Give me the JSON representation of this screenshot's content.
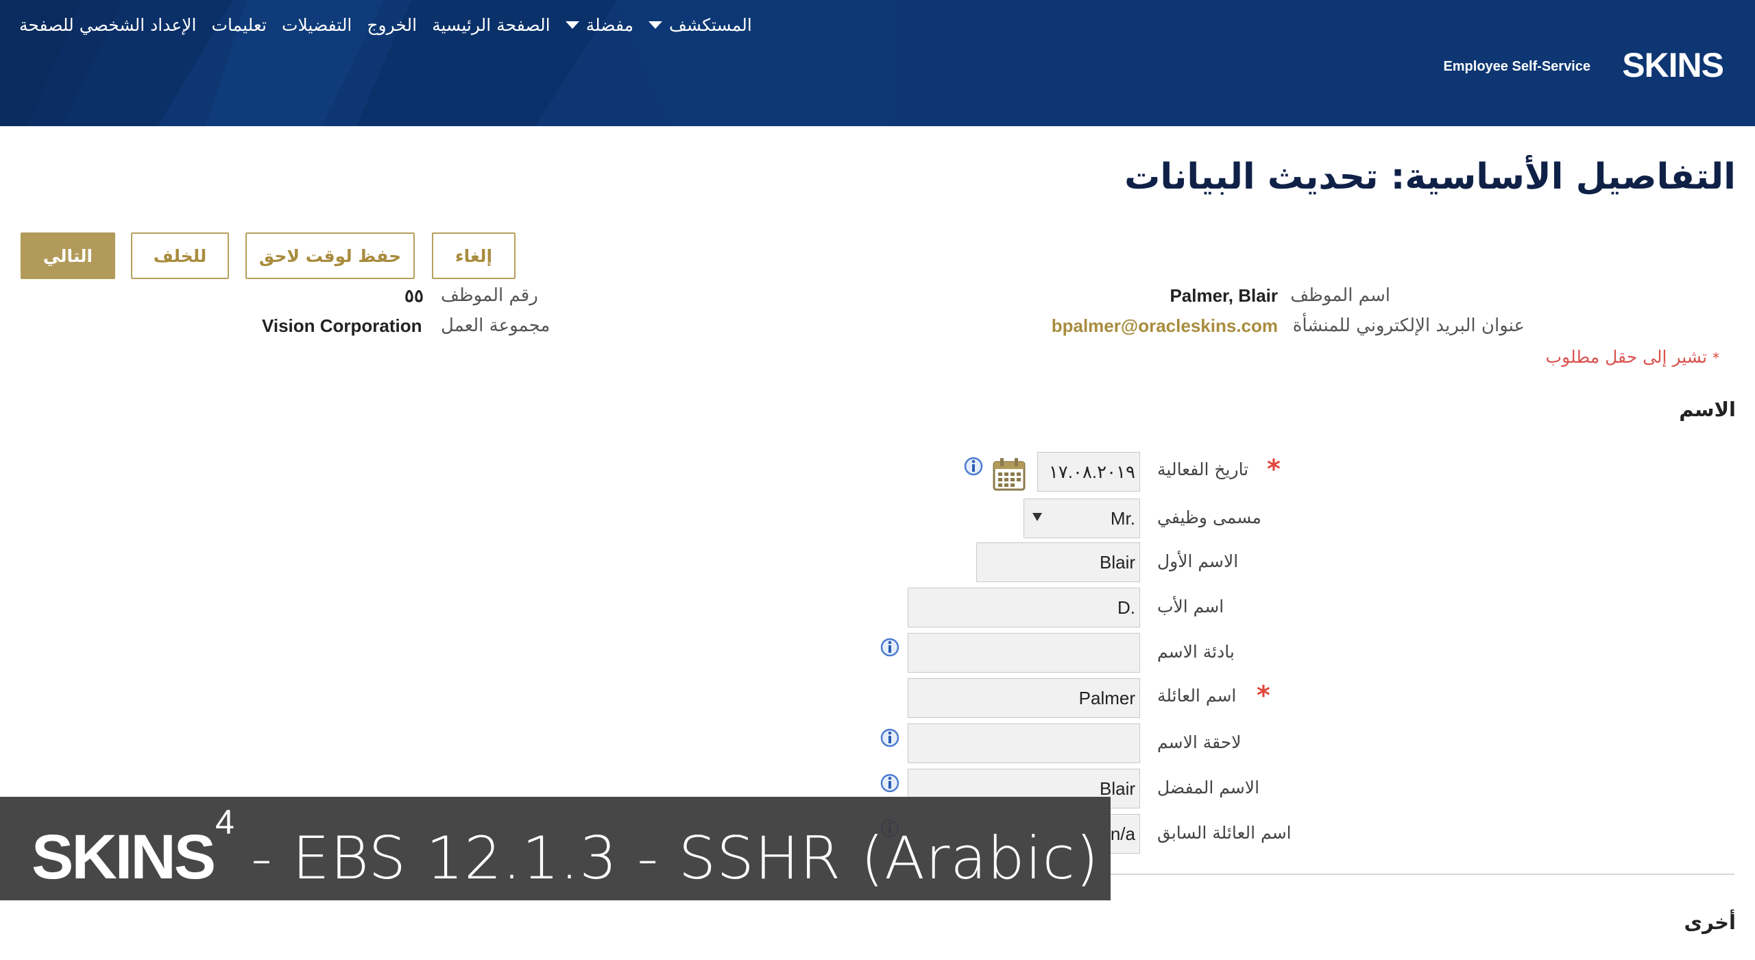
{
  "header": {
    "brand_logo": "SKINS",
    "brand_subtitle": "Employee Self-Service",
    "nav": [
      {
        "label": "المستكشف",
        "has_menu": true
      },
      {
        "label": "مفضلة",
        "has_menu": true
      },
      {
        "label": "الصفحة الرئيسية",
        "has_menu": false
      },
      {
        "label": "الخروج",
        "has_menu": false
      },
      {
        "label": "التفضيلات",
        "has_menu": false
      },
      {
        "label": "تعليمات",
        "has_menu": false
      },
      {
        "label": "الإعداد الشخصي للصفحة",
        "has_menu": false
      }
    ]
  },
  "page": {
    "title": "التفاصيل الأساسية: تحديث البيانات"
  },
  "actions": {
    "cancel": "إلغاء",
    "save_later": "حفظ لوقت لاحق",
    "back": "للخلف",
    "next": "التالي"
  },
  "employee": {
    "name_label": "اسم الموظف",
    "name_value": "Palmer, Blair",
    "email_label": "عنوان البريد الإلكتروني للمنشأة",
    "email_value": "bpalmer@oracleskins.com",
    "number_label": "رقم الموظف",
    "number_value": "٥٥",
    "org_label": "مجموعة العمل",
    "org_value": "Vision Corporation"
  },
  "required_note": "تشير إلى حقل مطلوب",
  "required_marker": "*",
  "sections": {
    "name": "الاسم",
    "other": "أخرى"
  },
  "form": {
    "effective_date": {
      "label": "تاريخ الفعالية",
      "value": "١٧.٠٨.٢٠١٩"
    },
    "title": {
      "label": "مسمى وظيفي",
      "value": "Mr."
    },
    "first_name": {
      "label": "الاسم الأول",
      "value": "Blair"
    },
    "middle_name": {
      "label": "اسم الأب",
      "value": "D."
    },
    "prefix": {
      "label": "بادئة الاسم",
      "value": ""
    },
    "last_name": {
      "label": "اسم العائلة",
      "value": "Palmer"
    },
    "suffix": {
      "label": "لاحقة الاسم",
      "value": ""
    },
    "preferred_name": {
      "label": "الاسم المفضل",
      "value": "Blair"
    },
    "previous_last_name": {
      "label": "اسم العائلة السابق",
      "value": "n/a"
    }
  },
  "overlay": {
    "logo": "SKINS",
    "superscript": "4",
    "caption": "- EBS 12.1.3 - SSHR (Arabic)"
  },
  "colors": {
    "header_bg": "#0d3672",
    "accent_gold": "#b29a5a",
    "required_red": "#e0463c",
    "title_navy": "#0f2147"
  }
}
